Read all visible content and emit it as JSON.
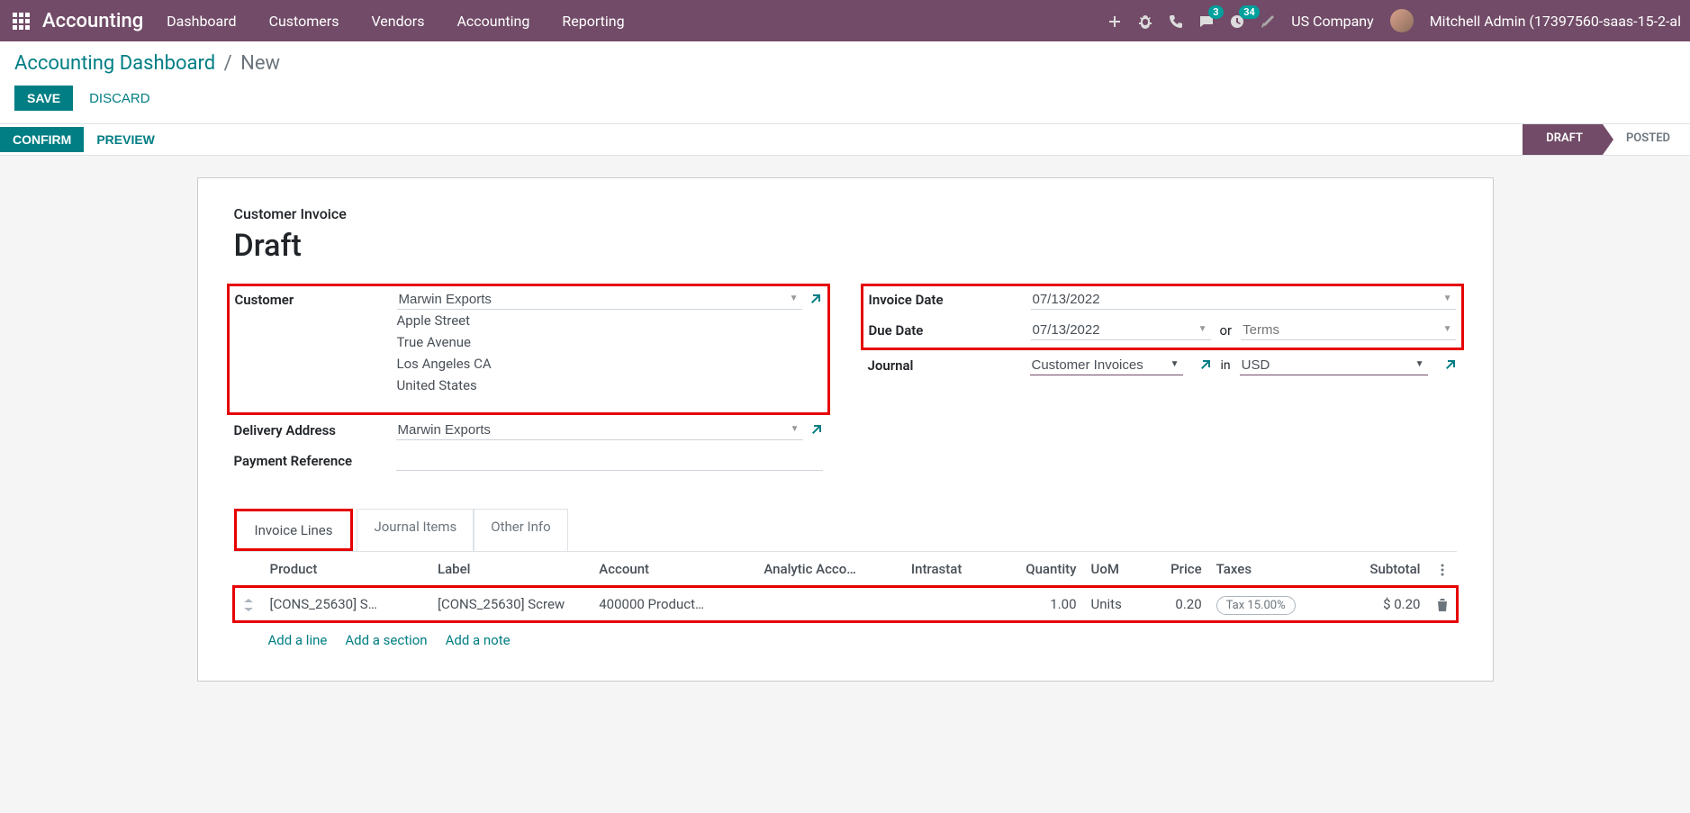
{
  "navbar": {
    "brand": "Accounting",
    "menu": [
      "Dashboard",
      "Customers",
      "Vendors",
      "Accounting",
      "Reporting"
    ],
    "messages_badge": "3",
    "activities_badge": "34",
    "company": "US Company",
    "user": "Mitchell Admin (17397560-saas-15-2-al"
  },
  "breadcrumb": {
    "parent": "Accounting Dashboard",
    "current": "New"
  },
  "buttons": {
    "save": "SAVE",
    "discard": "DISCARD",
    "confirm": "CONFIRM",
    "preview": "PREVIEW"
  },
  "status": {
    "draft": "DRAFT",
    "posted": "POSTED"
  },
  "form": {
    "subtitle": "Customer Invoice",
    "title": "Draft",
    "labels": {
      "customer": "Customer",
      "delivery_address": "Delivery Address",
      "payment_reference": "Payment Reference",
      "invoice_date": "Invoice Date",
      "due_date": "Due Date",
      "journal": "Journal"
    },
    "customer": {
      "name": "Marwin Exports",
      "street": "Apple Street",
      "street2": "True Avenue",
      "city": "Los Angeles CA",
      "country": "United States"
    },
    "delivery_address": "Marwin Exports",
    "payment_reference": "",
    "invoice_date": "07/13/2022",
    "due_date": "07/13/2022",
    "due_or": "or",
    "terms_placeholder": "Terms",
    "journal": "Customer Invoices",
    "journal_in": "in",
    "currency": "USD"
  },
  "tabs": {
    "invoice_lines": "Invoice Lines",
    "journal_items": "Journal Items",
    "other_info": "Other Info"
  },
  "table": {
    "headers": {
      "product": "Product",
      "label": "Label",
      "account": "Account",
      "analytic": "Analytic Acco…",
      "intrastat": "Intrastat",
      "quantity": "Quantity",
      "uom": "UoM",
      "price": "Price",
      "taxes": "Taxes",
      "subtotal": "Subtotal"
    },
    "row": {
      "product": "[CONS_25630] S…",
      "label": "[CONS_25630] Screw",
      "account": "400000 Product…",
      "analytic": "",
      "intrastat": "",
      "quantity": "1.00",
      "uom": "Units",
      "price": "0.20",
      "tax": "Tax 15.00%",
      "subtotal": "$ 0.20"
    },
    "actions": {
      "add_line": "Add a line",
      "add_section": "Add a section",
      "add_note": "Add a note"
    }
  }
}
